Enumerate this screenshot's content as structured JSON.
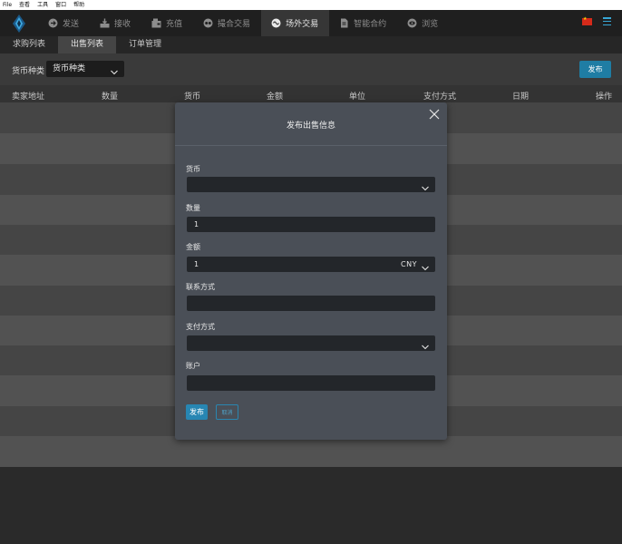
{
  "menubar": {
    "items": [
      "File",
      "查看",
      "工具",
      "窗口",
      "帮助"
    ]
  },
  "nav": {
    "items": [
      {
        "label": "发送",
        "icon": "send-icon",
        "active": false
      },
      {
        "label": "接收",
        "icon": "download-icon",
        "active": false
      },
      {
        "label": "充值",
        "icon": "wallet-icon",
        "active": false
      },
      {
        "label": "撮合交易",
        "icon": "exchange-icon",
        "active": false
      },
      {
        "label": "场外交易",
        "icon": "otc-icon",
        "active": true
      },
      {
        "label": "智能合约",
        "icon": "document-icon",
        "active": false
      },
      {
        "label": "浏览",
        "icon": "eye-icon",
        "active": false
      }
    ]
  },
  "tabs": [
    {
      "label": "求购列表",
      "active": false
    },
    {
      "label": "出售列表",
      "active": true
    },
    {
      "label": "订单管理",
      "active": false
    }
  ],
  "filter": {
    "label": "货币种类",
    "selected": "货币种类",
    "publish_label": "发布"
  },
  "table": {
    "columns": [
      "卖家地址",
      "数量",
      "货币",
      "金额",
      "单位",
      "支付方式",
      "日期",
      "操作"
    ]
  },
  "modal": {
    "title": "发布出售信息",
    "fields": {
      "currency": {
        "label": "货币",
        "value": ""
      },
      "quantity": {
        "label": "数量",
        "value": "1"
      },
      "amount": {
        "label": "金额",
        "value": "1",
        "unit": "CNY"
      },
      "contact": {
        "label": "联系方式",
        "value": ""
      },
      "payment": {
        "label": "支付方式",
        "value": ""
      },
      "account": {
        "label": "账户",
        "value": ""
      }
    },
    "publish_label": "发布",
    "cancel_label": "取消"
  },
  "colors": {
    "accent": "#1f7da4",
    "flag": "#d52a1a",
    "menu_icon": "#37a7d6"
  }
}
